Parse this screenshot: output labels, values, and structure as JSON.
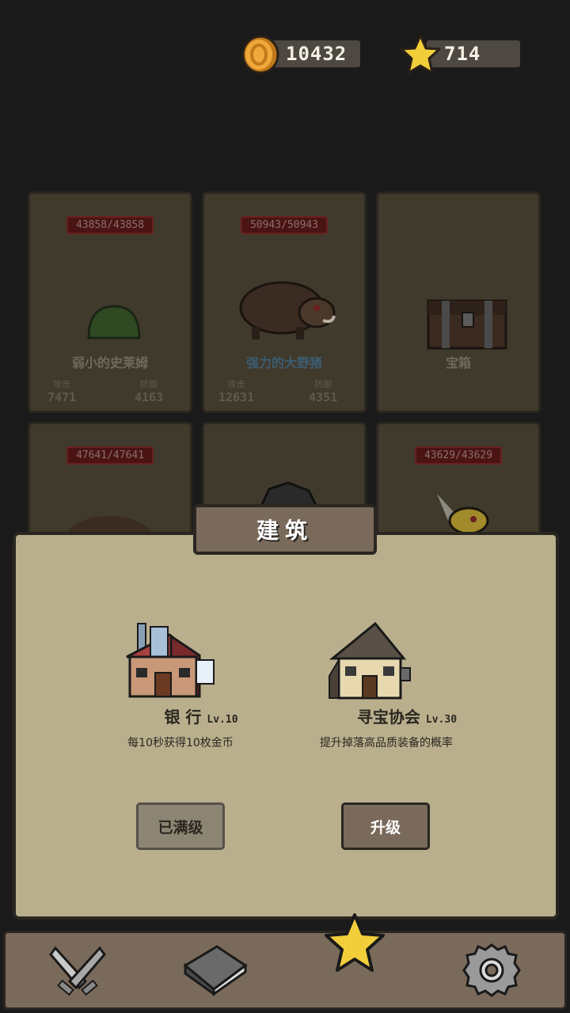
{
  "currency": {
    "coins": "10432",
    "stars": "714"
  },
  "monsters": [
    {
      "hp": "43858/43858",
      "name": "弱小的史莱姆",
      "atk_label": "攻击",
      "atk": "7471",
      "def_label": "防御",
      "def": "4163"
    },
    {
      "hp": "50943/50943",
      "name": "强力的大野猪",
      "atk_label": "攻击",
      "atk": "12631",
      "def_label": "防御",
      "def": "4351"
    },
    {
      "hp": "",
      "name": "宝箱"
    },
    {
      "hp": "47641/47641"
    },
    {
      "hp": ""
    },
    {
      "hp": "43629/43629"
    }
  ],
  "dialog": {
    "title": "建筑",
    "buildings": [
      {
        "name": "银 行",
        "level": "Lv.10",
        "desc": "每10秒获得10枚金币",
        "button": "已满级"
      },
      {
        "name": "寻宝协会",
        "level": "Lv.30",
        "desc": "提升掉落高品质装备的概率",
        "button": "升级"
      }
    ]
  },
  "nav": {
    "items": [
      {
        "icon": "crossed-swords-icon"
      },
      {
        "icon": "book-icon"
      },
      {
        "icon": "star-icon"
      },
      {
        "icon": "gear-icon"
      }
    ]
  }
}
